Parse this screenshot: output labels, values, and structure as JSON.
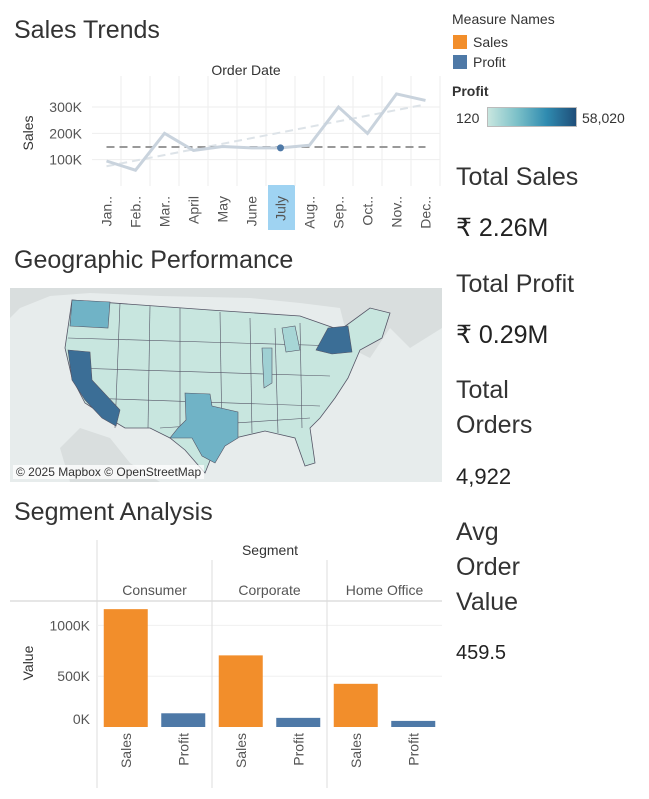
{
  "sections": {
    "sales_trends": "Sales Trends",
    "geographic": "Geographic Performance",
    "segment": "Segment Analysis"
  },
  "legend": {
    "measure_names_title": "Measure Names",
    "measure_items": [
      {
        "label": "Sales",
        "color": "#f28e2b"
      },
      {
        "label": "Profit",
        "color": "#4e79a7"
      }
    ],
    "profit_title": "Profit",
    "profit_min": "120",
    "profit_max": "58,020",
    "profit_gradient": [
      "#c8e6df",
      "#7bc0c8",
      "#2f8bb0",
      "#1f4e79"
    ]
  },
  "kpis": {
    "total_sales_label": "Total Sales",
    "total_sales_value": "₹ 2.26M",
    "total_profit_label": "Total Profit",
    "total_profit_value": "₹ 0.29M",
    "total_orders_label_1": "Total",
    "total_orders_label_2": "Orders",
    "total_orders_value": "4,922",
    "avg_order_label_1": "Avg",
    "avg_order_label_2": "Order",
    "avg_order_label_3": "Value",
    "avg_order_value": "459.5"
  },
  "map": {
    "attribution": "© 2025 Mapbox © OpenStreetMap",
    "highlight_colors": {
      "high": "#3b6e96",
      "mid": "#70b3c6",
      "low": "#c8e6df"
    }
  },
  "chart_data": [
    {
      "type": "line",
      "title": "Order Date",
      "ylabel": "Sales",
      "xlabel": "",
      "categories": [
        "Jan..",
        "Feb..",
        "Mar..",
        "April",
        "May",
        "June",
        "July",
        "Aug..",
        "Sep..",
        "Oct..",
        "Nov..",
        "Dec.."
      ],
      "selected_category": "July",
      "series": [
        {
          "values": [
            95000,
            60000,
            200000,
            135000,
            150000,
            145000,
            145000,
            155000,
            300000,
            200000,
            350000,
            325000
          ],
          "color": "#c9d3dd"
        }
      ],
      "average_line": 148000,
      "trend_line": [
        75000,
        310000
      ],
      "yticks": [
        100000,
        200000,
        300000
      ],
      "ytick_labels": [
        "100K",
        "200K",
        "300K"
      ],
      "ylim": [
        0,
        380000
      ]
    },
    {
      "type": "bar",
      "title": "Segment",
      "ylabel": "Value",
      "groups": [
        "Consumer",
        "Corporate",
        "Home Office"
      ],
      "categories": [
        "Sales",
        "Profit"
      ],
      "series": [
        {
          "name": "Sales",
          "values": [
            1160000,
            705000,
            425000
          ],
          "color": "#f28e2b"
        },
        {
          "name": "Profit",
          "values": [
            135000,
            90000,
            60000
          ],
          "color": "#4e79a7"
        }
      ],
      "yticks": [
        0,
        500000,
        1000000
      ],
      "ytick_labels": [
        "0K",
        "500K",
        "1000K"
      ],
      "ylim": [
        0,
        1250000
      ]
    }
  ]
}
